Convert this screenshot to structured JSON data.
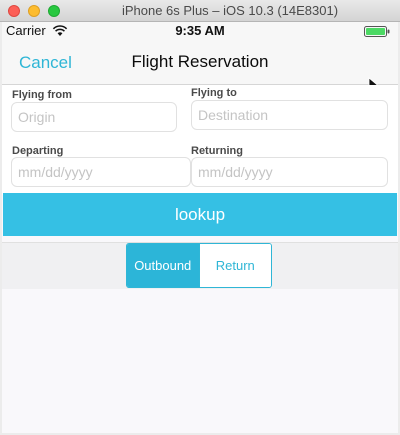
{
  "window": {
    "title": "iPhone 6s Plus – iOS 10.3 (14E8301)"
  },
  "statusbar": {
    "carrier": "Carrier",
    "time": "9:35 AM",
    "wifi_icon": "wifi-icon",
    "battery_icon": "battery-icon",
    "battery_color": "#4cd964"
  },
  "navbar": {
    "cancel_label": "Cancel",
    "title": "Flight Reservation",
    "accent_color": "#2fb6d6"
  },
  "form": {
    "flying_from": {
      "label": "Flying from",
      "placeholder": "Origin",
      "value": ""
    },
    "flying_to": {
      "label": "Flying to",
      "placeholder": "Destination",
      "value": ""
    },
    "departing": {
      "label": "Departing",
      "placeholder": "mm/dd/yyyy",
      "value": ""
    },
    "returning": {
      "label": "Returning",
      "placeholder": "mm/dd/yyyy",
      "value": ""
    }
  },
  "lookup": {
    "label": "lookup",
    "color": "#35c0e4"
  },
  "segments": {
    "items": [
      {
        "label": "Outbound",
        "selected": true
      },
      {
        "label": "Return",
        "selected": false
      }
    ]
  }
}
